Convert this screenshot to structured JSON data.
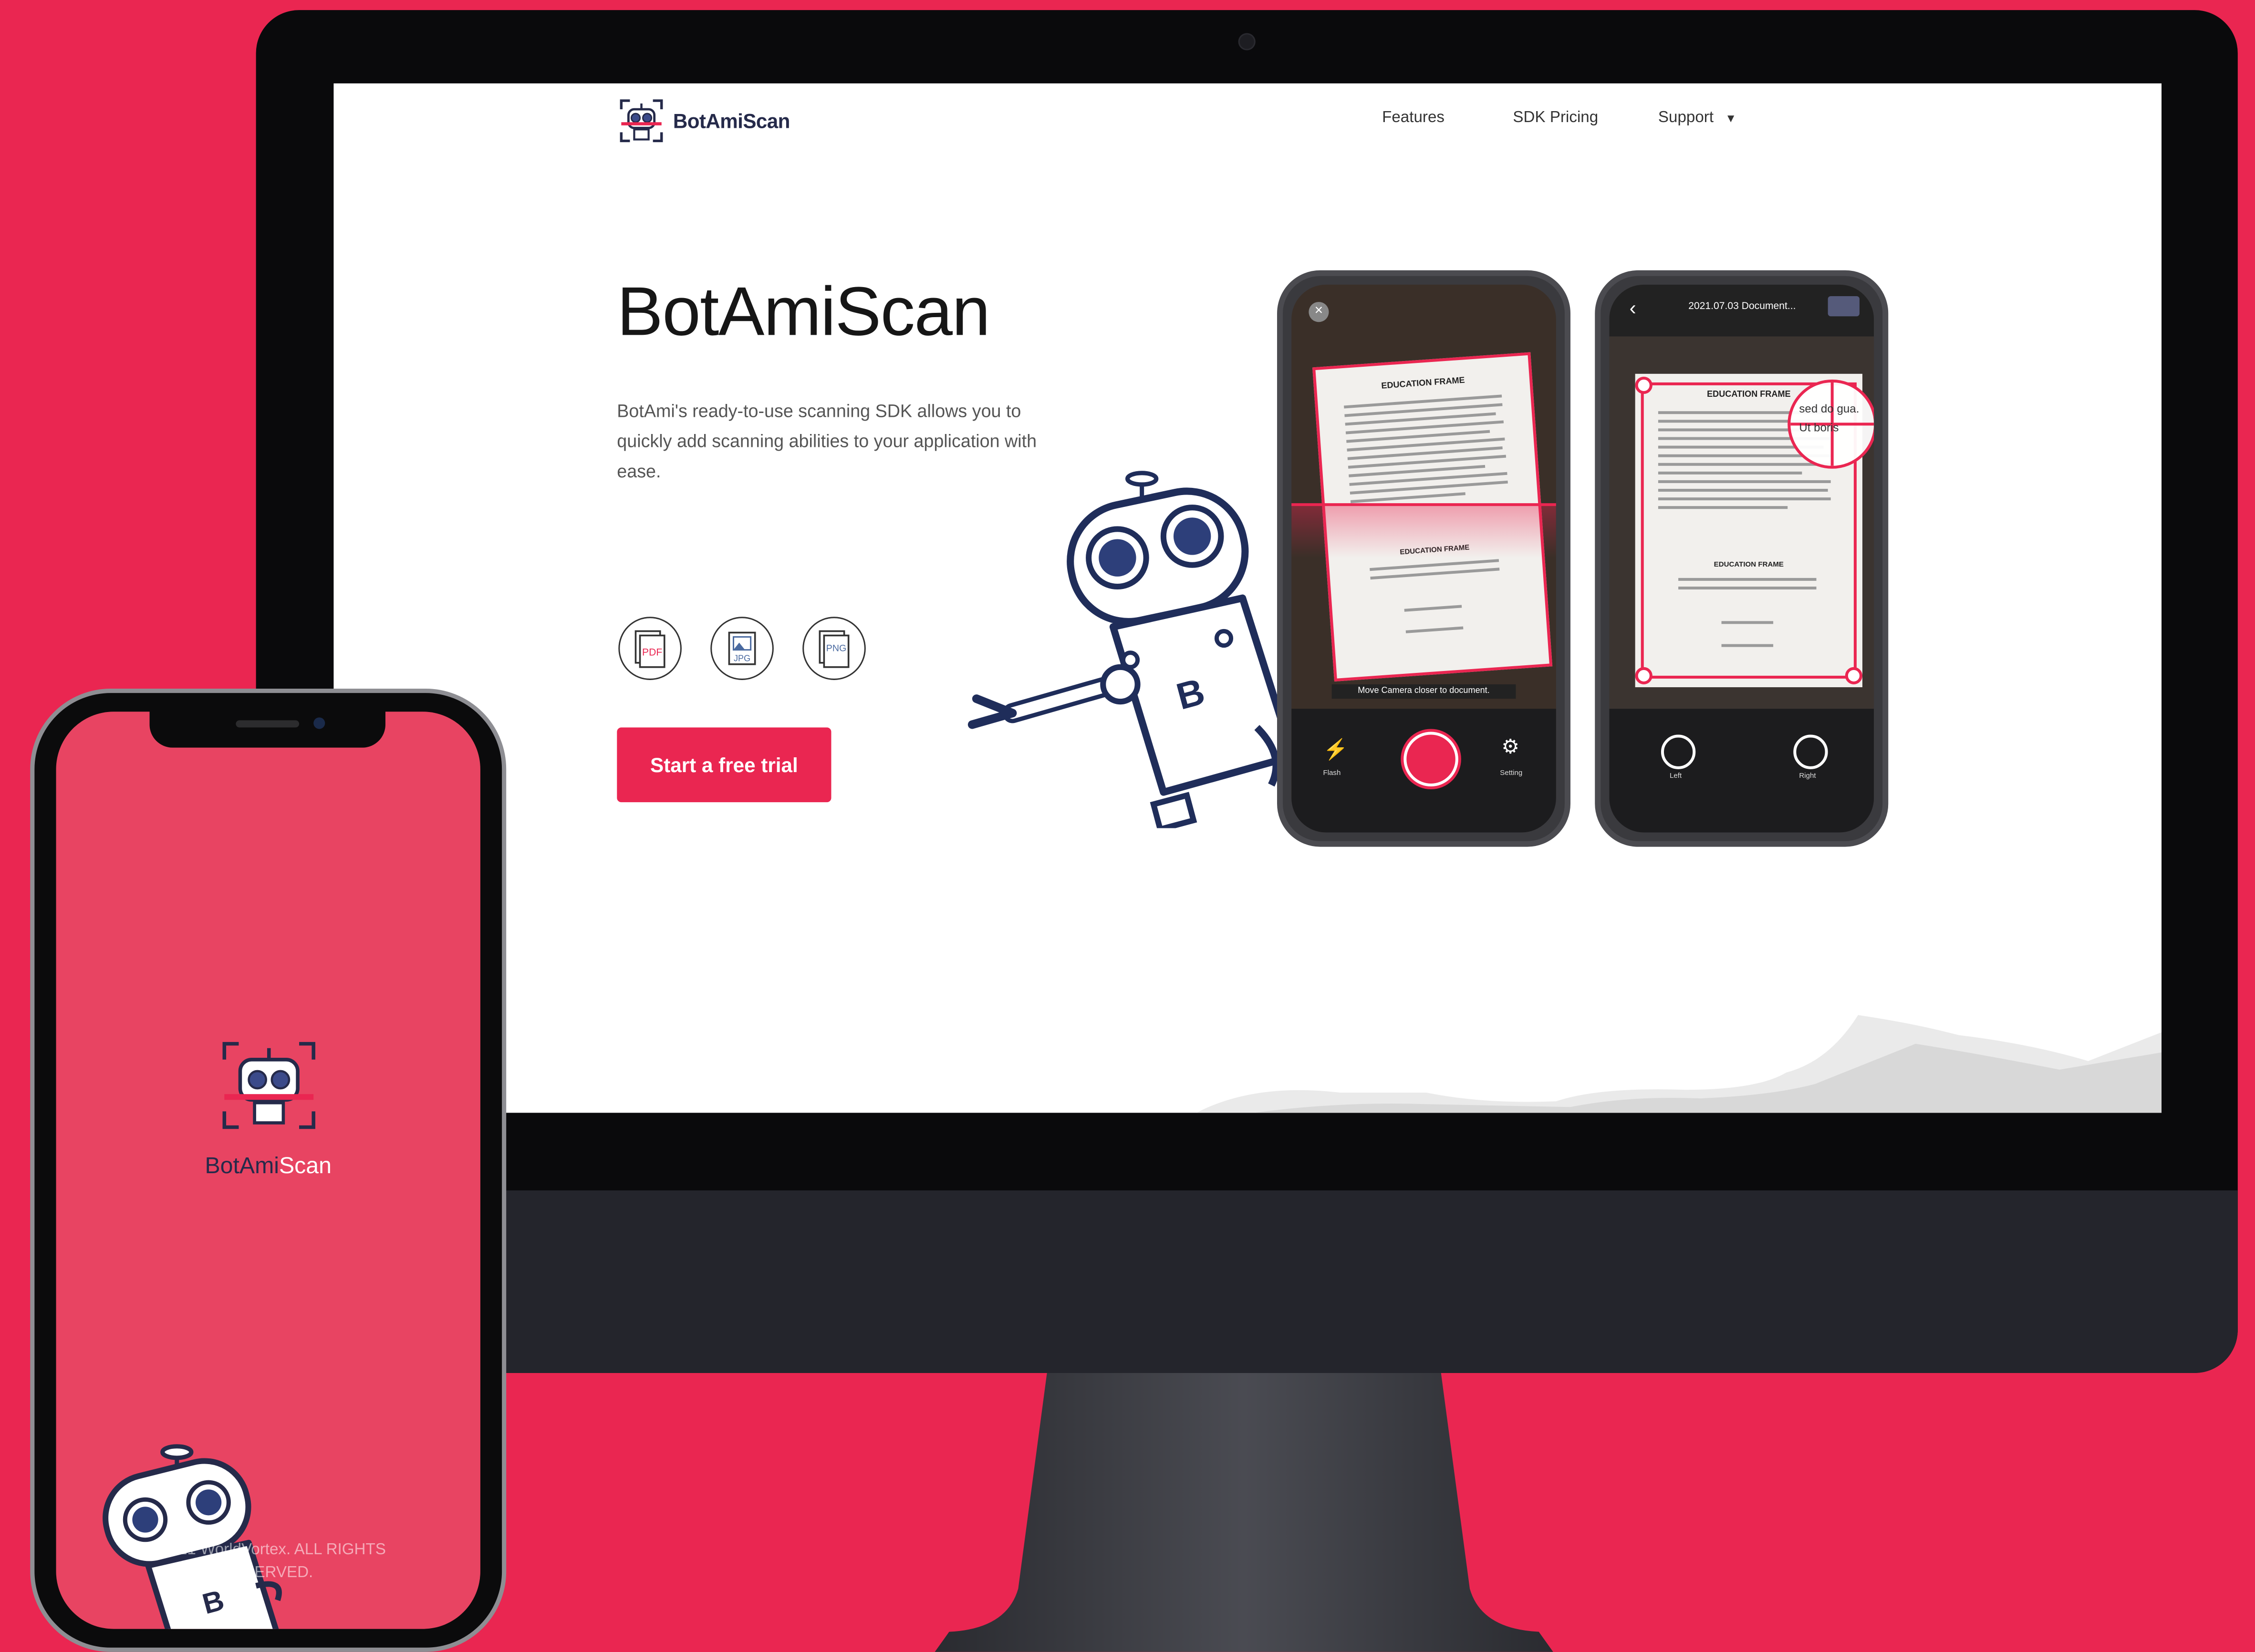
{
  "site": {
    "brand": {
      "name_primary": "BotAmi",
      "name_secondary": "Scan"
    },
    "nav": [
      {
        "label": "Features"
      },
      {
        "label": "SDK Pricing"
      },
      {
        "label": "Support"
      }
    ],
    "hero": {
      "title": "BotAmiScan",
      "description": "BotAmi's ready-to-use scanning SDK allows you to quickly add scanning abilities to your application with ease.",
      "formats": [
        "PDF",
        "JPG",
        "PNG"
      ],
      "cta_label": "Start a free trial"
    },
    "scan_phone": {
      "doc_title": "EDUCATION FRAME",
      "doc_subtitle": "EDUCATION FRAME",
      "hint": "Move Camera closer to document.",
      "actions": [
        "Flash",
        "Setting"
      ]
    },
    "edit_phone": {
      "title": "2021.07.03 Document...",
      "doc_title": "EDUCATION FRAME",
      "doc_subtitle": "EDUCATION FRAME",
      "magnifier_text": "sed do gua. Ut boris",
      "actions": [
        "Left",
        "Right"
      ]
    }
  },
  "mobile": {
    "brand": {
      "name_primary": "BotAmi",
      "name_secondary": "Scan"
    },
    "copyright": "©2021 WorldVortex. ALL RIGHTS RESERVED."
  },
  "colors": {
    "accent": "#ea2651",
    "navy": "#252a4a",
    "background": "#ea2651"
  }
}
